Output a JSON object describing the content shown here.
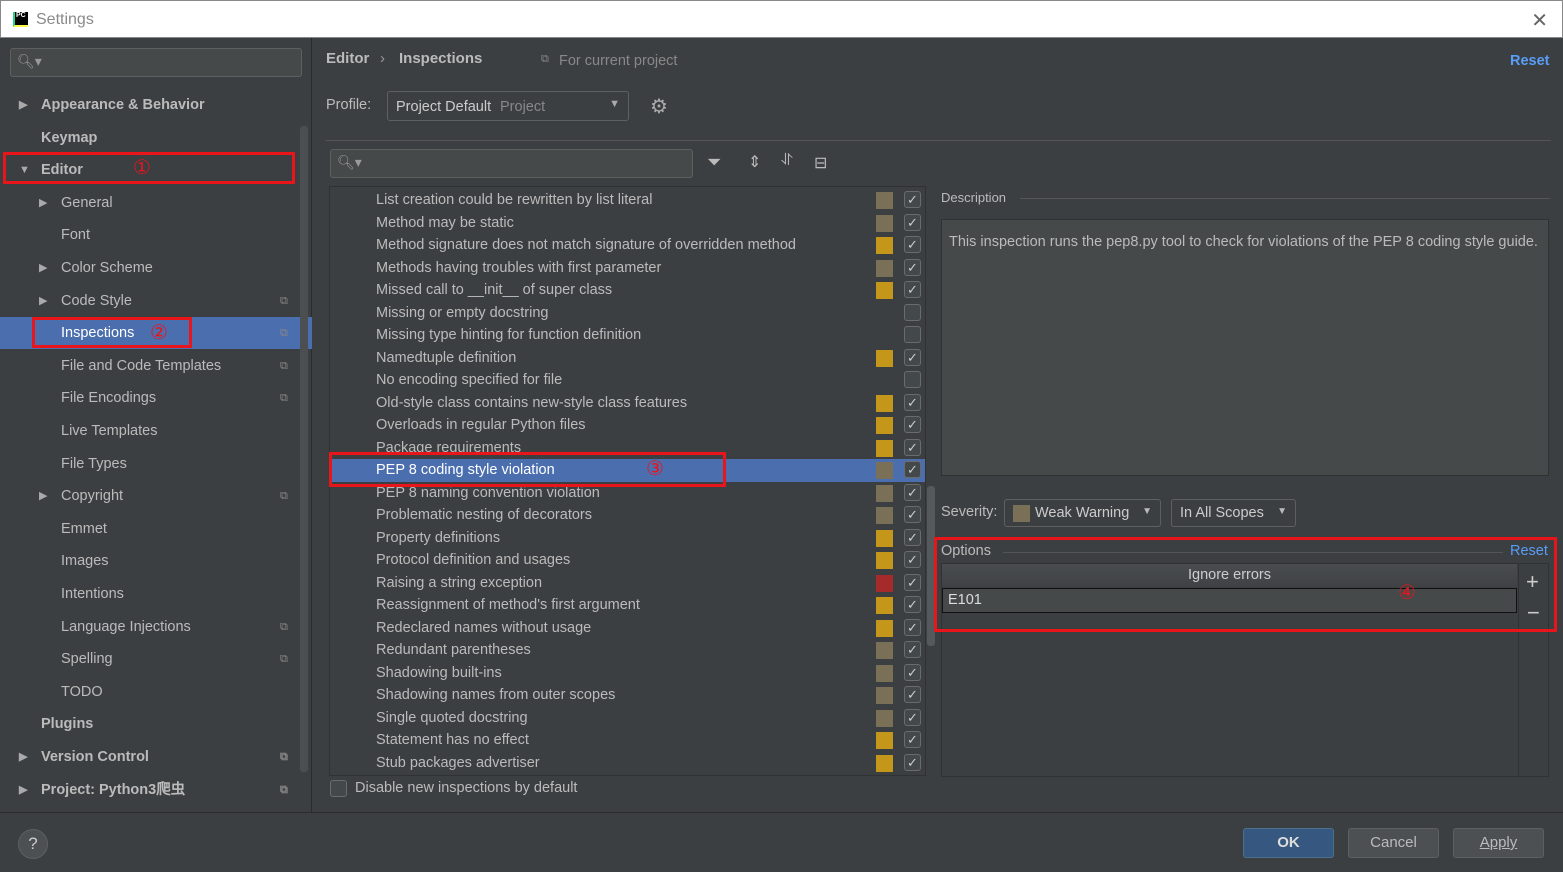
{
  "window": {
    "title": "Settings",
    "logo": "PC"
  },
  "sidebar": {
    "items": [
      {
        "label": "Appearance & Behavior",
        "bold": true,
        "arrow": "right",
        "indent": 0
      },
      {
        "label": "Keymap",
        "bold": true,
        "arrow": "",
        "indent": 0
      },
      {
        "label": "Editor",
        "bold": true,
        "arrow": "down",
        "indent": 0
      },
      {
        "label": "General",
        "arrow": "right",
        "indent": 1
      },
      {
        "label": "Font",
        "arrow": "",
        "indent": 1
      },
      {
        "label": "Color Scheme",
        "arrow": "right",
        "indent": 1
      },
      {
        "label": "Code Style",
        "arrow": "right",
        "indent": 1,
        "copy": true
      },
      {
        "label": "Inspections",
        "arrow": "",
        "indent": 1,
        "copy": true,
        "selected": true
      },
      {
        "label": "File and Code Templates",
        "arrow": "",
        "indent": 1,
        "copy": true
      },
      {
        "label": "File Encodings",
        "arrow": "",
        "indent": 1,
        "copy": true
      },
      {
        "label": "Live Templates",
        "arrow": "",
        "indent": 1
      },
      {
        "label": "File Types",
        "arrow": "",
        "indent": 1
      },
      {
        "label": "Copyright",
        "arrow": "right",
        "indent": 1,
        "copy": true
      },
      {
        "label": "Emmet",
        "arrow": "",
        "indent": 1
      },
      {
        "label": "Images",
        "arrow": "",
        "indent": 1
      },
      {
        "label": "Intentions",
        "arrow": "",
        "indent": 1
      },
      {
        "label": "Language Injections",
        "arrow": "",
        "indent": 1,
        "copy": true
      },
      {
        "label": "Spelling",
        "arrow": "",
        "indent": 1,
        "copy": true
      },
      {
        "label": "TODO",
        "arrow": "",
        "indent": 1
      },
      {
        "label": "Plugins",
        "bold": true,
        "arrow": "",
        "indent": 0
      },
      {
        "label": "Version Control",
        "bold": true,
        "arrow": "right",
        "indent": 0,
        "copy": true
      },
      {
        "label": "Project: Python3爬虫",
        "bold": true,
        "arrow": "right",
        "indent": 0,
        "copy": true
      }
    ]
  },
  "annotations": [
    "①",
    "②",
    "③",
    "④"
  ],
  "breadcrumb": {
    "parent": "Editor",
    "sep": "›",
    "current": "Inspections",
    "scope": "For current project",
    "reset": "Reset"
  },
  "profile": {
    "label": "Profile:",
    "value": "Project Default",
    "type": "Project"
  },
  "colors": {
    "weak": "#7a7057",
    "warning": "#c4961a",
    "error": "#a52a2a",
    "selected": "#4b6eaf",
    "link": "#589df6"
  },
  "inspections": [
    {
      "label": "List creation could be rewritten by list literal",
      "sev": "weak",
      "on": true
    },
    {
      "label": "Method may be static",
      "sev": "weak",
      "on": true
    },
    {
      "label": "Method signature does not match signature of overridden method",
      "sev": "warning",
      "on": true
    },
    {
      "label": "Methods having troubles with first parameter",
      "sev": "weak",
      "on": true
    },
    {
      "label": "Missed call to __init__ of super class",
      "sev": "warning",
      "on": true
    },
    {
      "label": "Missing or empty docstring",
      "sev": "",
      "on": false
    },
    {
      "label": "Missing type hinting for function definition",
      "sev": "",
      "on": false
    },
    {
      "label": "Namedtuple definition",
      "sev": "warning",
      "on": true
    },
    {
      "label": "No encoding specified for file",
      "sev": "",
      "on": false
    },
    {
      "label": "Old-style class contains new-style class features",
      "sev": "warning",
      "on": true
    },
    {
      "label": "Overloads in regular Python files",
      "sev": "warning",
      "on": true
    },
    {
      "label": "Package requirements",
      "sev": "warning",
      "on": true
    },
    {
      "label": "PEP 8 coding style violation",
      "sev": "weak",
      "on": true,
      "selected": true
    },
    {
      "label": "PEP 8 naming convention violation",
      "sev": "weak",
      "on": true
    },
    {
      "label": "Problematic nesting of decorators",
      "sev": "weak",
      "on": true
    },
    {
      "label": "Property definitions",
      "sev": "warning",
      "on": true
    },
    {
      "label": "Protocol definition and usages",
      "sev": "warning",
      "on": true
    },
    {
      "label": "Raising a string exception",
      "sev": "error",
      "on": true
    },
    {
      "label": "Reassignment of method's first argument",
      "sev": "warning",
      "on": true
    },
    {
      "label": "Redeclared names without usage",
      "sev": "warning",
      "on": true
    },
    {
      "label": "Redundant parentheses",
      "sev": "weak",
      "on": true
    },
    {
      "label": "Shadowing built-ins",
      "sev": "weak",
      "on": true
    },
    {
      "label": "Shadowing names from outer scopes",
      "sev": "weak",
      "on": true
    },
    {
      "label": "Single quoted docstring",
      "sev": "weak",
      "on": true
    },
    {
      "label": "Statement has no effect",
      "sev": "warning",
      "on": true
    },
    {
      "label": "Stub packages advertiser",
      "sev": "warning",
      "on": true
    }
  ],
  "disable_new": {
    "label": "Disable new inspections by default",
    "checked": false
  },
  "description": {
    "title": "Description",
    "text": "This inspection runs the pep8.py tool to check for violations of the PEP 8 coding style guide."
  },
  "severity": {
    "label": "Severity:",
    "value": "Weak Warning",
    "scope": "In All Scopes"
  },
  "options": {
    "title": "Options",
    "reset": "Reset",
    "column": "Ignore errors",
    "values": [
      "E101"
    ],
    "add": "+",
    "remove": "−"
  },
  "footer": {
    "help": "?",
    "ok": "OK",
    "cancel": "Cancel",
    "apply": "Apply"
  }
}
